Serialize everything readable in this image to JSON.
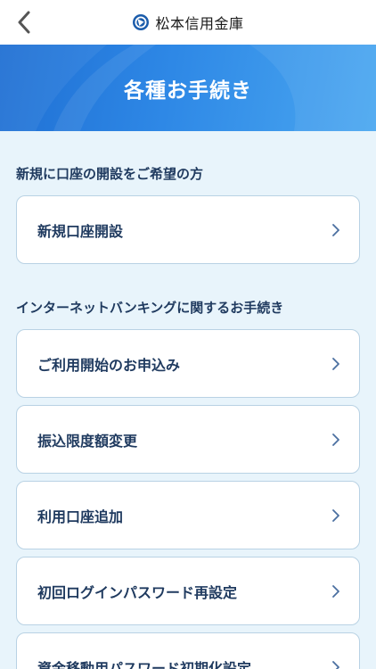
{
  "nav": {
    "brand_name": "松本信用金庫"
  },
  "banner": {
    "title": "各種お手続き"
  },
  "sections": [
    {
      "title": "新規に口座の開設をご希望の方",
      "items": [
        {
          "label": "新規口座開設"
        }
      ]
    },
    {
      "title": "インターネットバンキングに関するお手続き",
      "items": [
        {
          "label": "ご利用開始のお申込み"
        },
        {
          "label": "振込限度額変更"
        },
        {
          "label": "利用口座追加"
        },
        {
          "label": "初回ログインパスワード再設定"
        },
        {
          "label": "資金移動用パスワード初期化設定"
        }
      ]
    }
  ],
  "colors": {
    "accent": "#2e88e6",
    "text": "#1f3a5f",
    "background": "#e8f4fb",
    "card_border": "#b9d2e4"
  },
  "icons": {
    "back": "chevron-left-icon",
    "logo": "bank-logo-icon",
    "row_arrow": "chevron-right-icon"
  }
}
